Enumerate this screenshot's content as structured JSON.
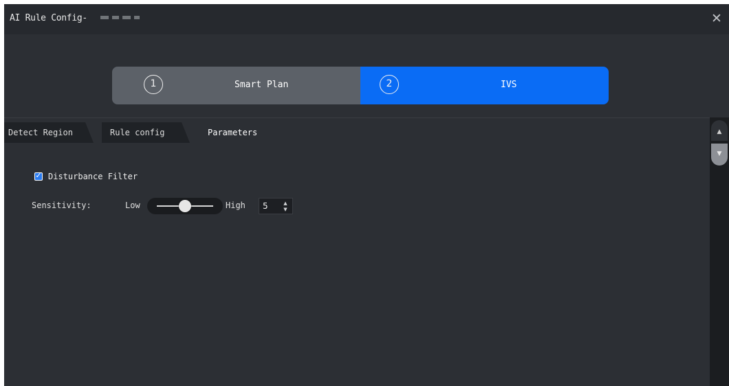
{
  "window": {
    "title": "AI Rule Config-",
    "close_icon": "close-icon"
  },
  "steps": [
    {
      "number": "1",
      "label": "Smart Plan",
      "active": false
    },
    {
      "number": "2",
      "label": "IVS",
      "active": true
    }
  ],
  "tabs": [
    {
      "label": "Detect Region",
      "active": false
    },
    {
      "label": "Rule config",
      "active": false
    },
    {
      "label": "Parameters",
      "active": true
    }
  ],
  "parameters": {
    "disturbance_filter": {
      "label": "Disturbance Filter",
      "checked": true
    },
    "sensitivity": {
      "label": "Sensitivity:",
      "low_label": "Low",
      "high_label": "High",
      "value": "5",
      "slider_fraction": 0.5
    }
  },
  "colors": {
    "accent": "#0a6cf5",
    "inactive_step": "#5c6168",
    "background": "#2c2f34"
  },
  "scrollbar": {
    "up_icon": "chevron-up-icon",
    "down_icon": "chevron-down-icon"
  }
}
